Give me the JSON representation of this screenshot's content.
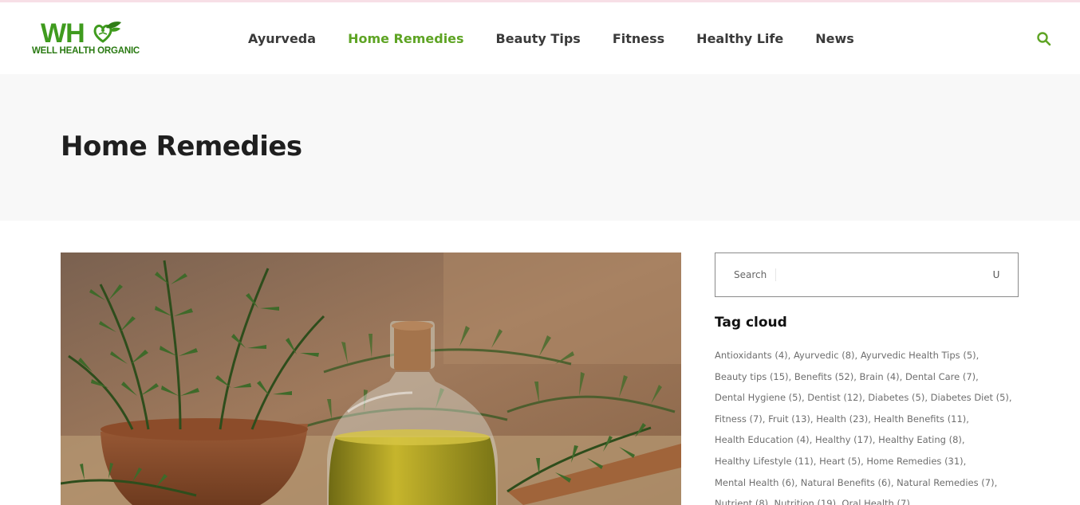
{
  "brand": {
    "logo_mark": "WH",
    "logo_subtitle": "WELL HEALTH ORGANIC",
    "logo_icon": "heart-leaf-icon",
    "primary_color": "#5ea424",
    "logo_color": "#3f9b1e"
  },
  "nav": {
    "items": [
      {
        "label": "Ayurveda",
        "active": false
      },
      {
        "label": "Home Remedies",
        "active": true
      },
      {
        "label": "Beauty Tips",
        "active": false
      },
      {
        "label": "Fitness",
        "active": false
      },
      {
        "label": "Healthy Life",
        "active": false
      },
      {
        "label": "News",
        "active": false
      }
    ],
    "search_icon": "search-icon"
  },
  "page": {
    "title": "Home Remedies"
  },
  "post": {
    "image_icon": "rosemary-oil-bottle-image"
  },
  "sidebar": {
    "search": {
      "placeholder": "Search",
      "submit_glyph": "U"
    },
    "tag_cloud": {
      "title": "Tag cloud",
      "lines": [
        [
          {
            "name": "Antioxidants",
            "count": "(4)"
          },
          {
            "name": "Ayurvedic",
            "count": "(8)"
          },
          {
            "name": "Ayurvedic Health Tips",
            "count": "(5)"
          }
        ],
        [
          {
            "name": "Beauty tips",
            "count": "(15)"
          },
          {
            "name": "Benefits",
            "count": "(52)"
          },
          {
            "name": "Brain",
            "count": "(4)"
          },
          {
            "name": "Dental Care",
            "count": "(7)"
          }
        ],
        [
          {
            "name": "Dental Hygiene",
            "count": "(5)"
          },
          {
            "name": "Dentist",
            "count": "(12)"
          },
          {
            "name": "Diabetes",
            "count": "(5)"
          },
          {
            "name": "Diabetes Diet",
            "count": "(5)"
          }
        ],
        [
          {
            "name": "Fitness",
            "count": "(7)"
          },
          {
            "name": "Fruit",
            "count": "(13)"
          },
          {
            "name": "Health",
            "count": "(23)"
          },
          {
            "name": "Health Benefits",
            "count": "(11)"
          }
        ],
        [
          {
            "name": "Health Education",
            "count": "(4)"
          },
          {
            "name": "Healthy",
            "count": "(17)"
          },
          {
            "name": "Healthy Eating",
            "count": "(8)"
          }
        ],
        [
          {
            "name": "Healthy Lifestyle",
            "count": "(11)"
          },
          {
            "name": "Heart",
            "count": "(5)"
          },
          {
            "name": "Home Remedies",
            "count": "(31)"
          }
        ],
        [
          {
            "name": "Mental Health",
            "count": "(6)"
          },
          {
            "name": "Natural Benefits",
            "count": "(6)"
          },
          {
            "name": "Natural Remedies",
            "count": "(7)"
          }
        ],
        [
          {
            "name": "Nutrient",
            "count": "(8)"
          },
          {
            "name": "Nutrition",
            "count": "(19)"
          },
          {
            "name": "Oral Health",
            "count": "(7)"
          }
        ]
      ]
    }
  }
}
